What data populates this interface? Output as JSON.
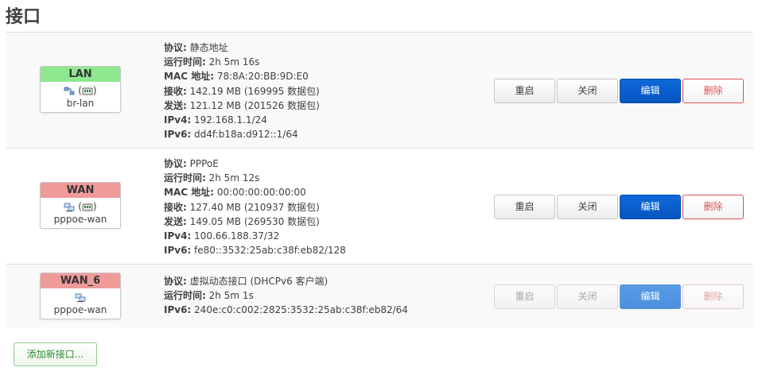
{
  "page": {
    "title": "接口"
  },
  "interfaces": [
    {
      "name": "LAN",
      "name_color": "#8fe88f",
      "icons_text": "(",
      "icons_text_end": ")",
      "device": "br-lan",
      "info": [
        {
          "k": "协议:",
          "v": " 静态地址"
        },
        {
          "k": "运行时间:",
          "v": " 2h 5m 16s"
        },
        {
          "k": "MAC 地址:",
          "v": " 78:8A:20:BB:9D:E0"
        },
        {
          "k": "接收:",
          "v": " 142.19 MB (169995 数据包)"
        },
        {
          "k": "发送:",
          "v": " 121.12 MB (201526 数据包)"
        },
        {
          "k": "IPv4:",
          "v": " 192.168.1.1/24"
        },
        {
          "k": "IPv6:",
          "v": " dd4f:b18a:d912::1/64"
        }
      ]
    },
    {
      "name": "WAN",
      "name_color": "#f09a9a",
      "icons_text": "(",
      "icons_text_end": ")",
      "device": "pppoe-wan",
      "info": [
        {
          "k": "协议:",
          "v": " PPPoE"
        },
        {
          "k": "运行时间:",
          "v": " 2h 5m 12s"
        },
        {
          "k": "MAC 地址:",
          "v": " 00:00:00:00:00:00"
        },
        {
          "k": "接收:",
          "v": " 127.40 MB (210937 数据包)"
        },
        {
          "k": "发送:",
          "v": " 149.05 MB (269530 数据包)"
        },
        {
          "k": "IPv4:",
          "v": " 100.66.188.37/32"
        },
        {
          "k": "IPv6:",
          "v": " fe80::3532:25ab:c38f:eb82/128"
        }
      ]
    },
    {
      "name": "WAN_6",
      "name_color": "#f09a9a",
      "device": "pppoe-wan",
      "info": [
        {
          "k": "协议:",
          "v": " 虚拟动态接口 (DHCPv6 客户端)"
        },
        {
          "k": "运行时间:",
          "v": " 2h 5m 1s"
        },
        {
          "k": "IPv6:",
          "v": " 240e:c0:c002:2825:3532:25ab:c38f:eb82/64"
        }
      ]
    }
  ],
  "buttons": {
    "restart": "重启",
    "stop": "关闭",
    "edit": "编辑",
    "delete": "删除"
  },
  "add_button": "添加新接口..."
}
